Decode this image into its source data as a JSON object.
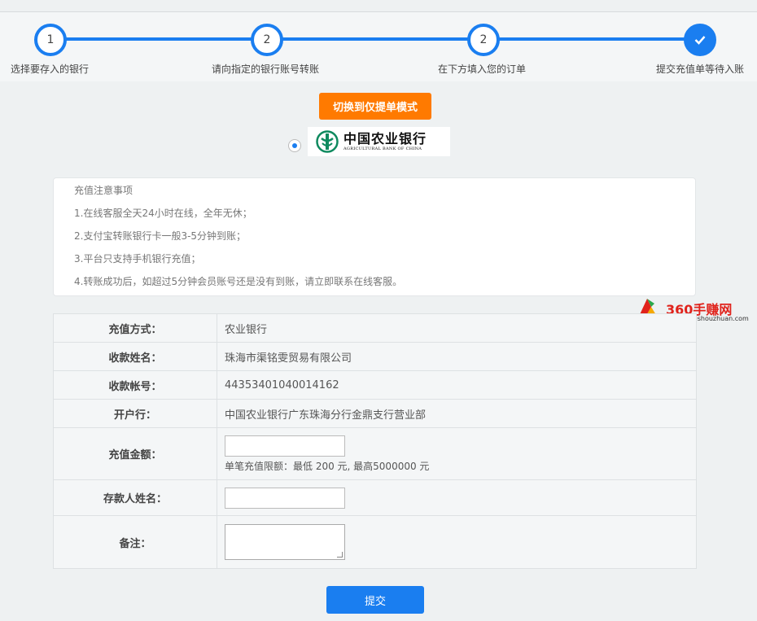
{
  "steps": [
    {
      "number": "1",
      "label": "选择要存入的银行"
    },
    {
      "number": "2",
      "label": "请向指定的银行账号转账"
    },
    {
      "number": "2",
      "label": "在下方填入您的订单"
    },
    {
      "number": "",
      "label": "提交充值单等待入账"
    }
  ],
  "switch_button": "切换到仅提单模式",
  "bank": {
    "name_cn": "中国农业银行",
    "name_en": "AGRICULTURAL BANK OF CHINA"
  },
  "notice": {
    "title": "充值注意事项",
    "items": [
      "1.在线客服全天24小时在线，全年无休；",
      "2.支付宝转账银行卡一般3-5分钟到账；",
      "3.平台只支持手机银行充值；",
      "4.转账成功后，如超过5分钟会员账号还是没有到账，请立即联系在线客服。"
    ]
  },
  "watermark": {
    "title": "360手赚网",
    "url": "www.360shouzhuan.com"
  },
  "form": {
    "method_label": "充值方式：",
    "method_value": "农业银行",
    "payee_label": "收款姓名：",
    "payee_value": "珠海市渠铭雯贸易有限公司",
    "account_label": "收款帐号：",
    "account_value": "44353401040014162",
    "branch_label": "开户行：",
    "branch_value": "中国农业银行广东珠海分行金鼎支行营业部",
    "amount_label": "充值金额：",
    "amount_hint": "单笔充值限额：最低 200 元, 最高5000000 元",
    "depositor_label": "存款人姓名：",
    "remark_label": "备注："
  },
  "submit_button": "提交",
  "colors": {
    "primary": "#1a7ef0",
    "orange": "#ff7a00",
    "background": "#eef1f2"
  }
}
